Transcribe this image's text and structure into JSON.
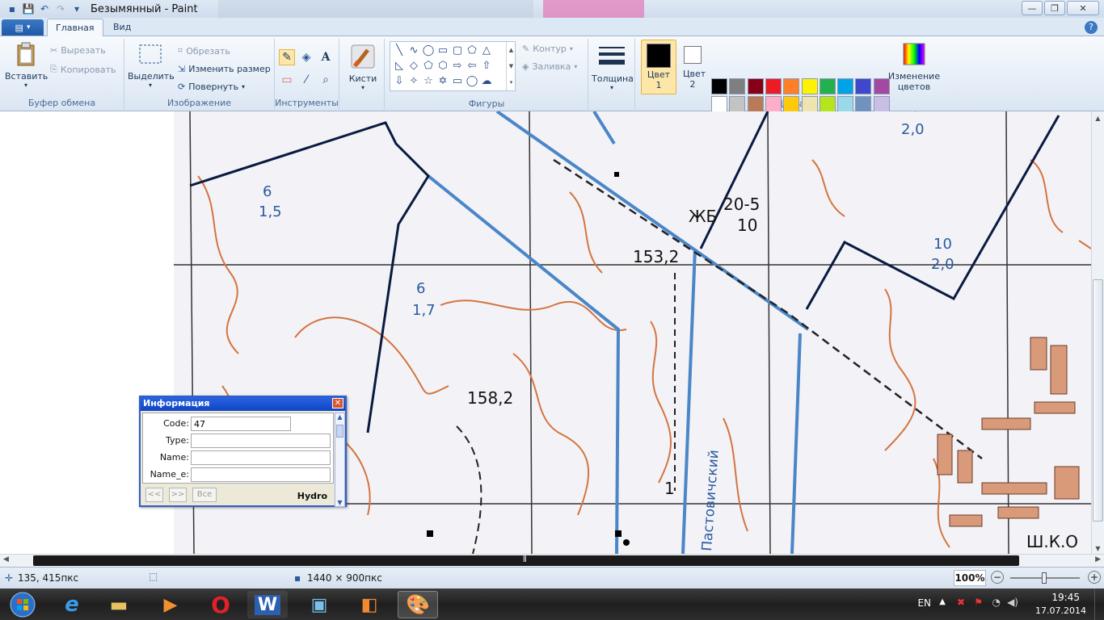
{
  "window": {
    "title": "Безымянный - Paint",
    "controls": [
      "minimize",
      "maximize",
      "close"
    ]
  },
  "tabs": [
    {
      "label": "Главная",
      "active": true
    },
    {
      "label": "Вид",
      "active": false
    }
  ],
  "ribbon": {
    "clipboard": {
      "label": "Буфер обмена",
      "paste": "Вставить",
      "cut": "Вырезать",
      "copy": "Копировать"
    },
    "image": {
      "label": "Изображение",
      "select": "Выделить",
      "crop": "Обрезать",
      "resize": "Изменить размер",
      "rotate": "Повернуть"
    },
    "tools": {
      "label": "Инструменты"
    },
    "brushes": {
      "label": "Кисти"
    },
    "shapes": {
      "label": "Фигуры",
      "outline": "Контур",
      "fill": "Заливка"
    },
    "size": {
      "label": "Толщина"
    },
    "color1": {
      "label": "Цвет 1",
      "color": "#000000"
    },
    "color2": {
      "label": "Цвет 2",
      "color": "#ffffff"
    },
    "colors": {
      "label": "Цвета",
      "edit": "Изменение цветов",
      "palette_row1": [
        "#000000",
        "#7f7f7f",
        "#880015",
        "#ed1c24",
        "#ff7f27",
        "#fff200",
        "#22b14c",
        "#00a2e8",
        "#3f48cc",
        "#a349a4"
      ],
      "palette_row2": [
        "#ffffff",
        "#c3c3c3",
        "#b97a57",
        "#ffaec9",
        "#ffc90e",
        "#efe4b0",
        "#b5e61d",
        "#99d9ea",
        "#7092be",
        "#c8bfe7"
      ]
    }
  },
  "map": {
    "labels": [
      "6",
      "1,5",
      "6",
      "1,7",
      "153,2",
      "ЖБ",
      "20-5",
      "10",
      "10",
      "2,0",
      "10",
      "2,0",
      "158,2",
      "Пастовичский",
      "1",
      "Ш.К.О"
    ]
  },
  "info_dialog": {
    "title": "Информация",
    "fields": [
      {
        "label": "Code:",
        "value": "47"
      },
      {
        "label": "Type:",
        "value": ""
      },
      {
        "label": "Name:",
        "value": ""
      },
      {
        "label": "Name_e:",
        "value": ""
      }
    ],
    "prev": "<<",
    "next": ">>",
    "all": "Все",
    "layer": "Hydro"
  },
  "status": {
    "cursor": "135, 415пкс",
    "dimensions": "1440 × 900пкс",
    "zoom": "100%"
  },
  "taskbar": {
    "lang": "EN",
    "time": "19:45",
    "date": "17.07.2014"
  }
}
